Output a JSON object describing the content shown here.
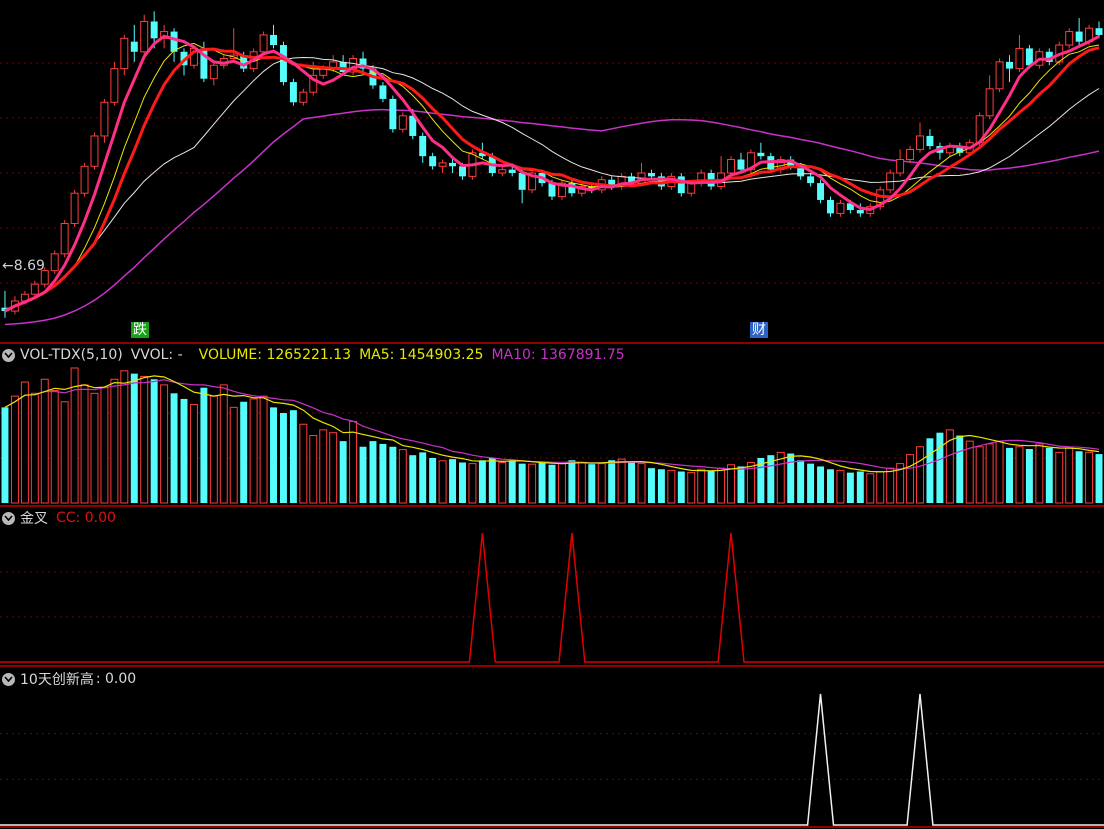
{
  "colors": {
    "background": "#000000",
    "up": "#ff3c3c",
    "down": "#54fcfc",
    "ma_fast": "#ff2f88",
    "ma_mid": "#ff1a1a",
    "ma_yellow": "#e8e800",
    "ma_white": "#e6e6e6",
    "ma_long": "#c832c8",
    "separator": "#c00000",
    "grid": "#7a0000"
  },
  "price_panel": {
    "low_label": "8.69",
    "event_tags": [
      {
        "text": "跌",
        "bar": 13,
        "color": "#18a018"
      },
      {
        "text": "财",
        "bar": 76,
        "color": "#2b63c8"
      }
    ]
  },
  "volume_panel": {
    "indicator": "VOL-TDX(5,10)",
    "vvol": "VVOL: -",
    "volume": "VOLUME: 1265221.13",
    "ma5": "MA5: 1454903.25",
    "ma10": "MA10: 1367891.75",
    "icon": "chevron-down-icon"
  },
  "gold_cross_panel": {
    "title": "金叉",
    "value": "CC: 0.00",
    "icon": "chevron-down-icon"
  },
  "new_high_panel": {
    "title": "10天创新高",
    "value": ": 0.00",
    "icon": "chevron-down-icon"
  },
  "chart_data": [
    {
      "type": "candlestick",
      "title": "",
      "bar_count": 111,
      "ylim": [
        8.3,
        13.2
      ],
      "y_reference": 8.69,
      "candles": [
        [
          8.75,
          8.7,
          9.0,
          8.6
        ],
        [
          8.7,
          8.85,
          8.92,
          8.65
        ],
        [
          8.85,
          8.95,
          9.0,
          8.8
        ],
        [
          8.95,
          9.1,
          9.15,
          8.9
        ],
        [
          9.1,
          9.3,
          9.35,
          9.05
        ],
        [
          9.3,
          9.55,
          9.6,
          9.25
        ],
        [
          9.55,
          10.0,
          10.05,
          9.5
        ],
        [
          10.0,
          10.45,
          10.5,
          9.95
        ],
        [
          10.45,
          10.85,
          10.9,
          10.4
        ],
        [
          10.85,
          11.3,
          11.35,
          10.8
        ],
        [
          11.3,
          11.8,
          11.85,
          11.2
        ],
        [
          11.8,
          12.3,
          12.4,
          11.75
        ],
        [
          12.3,
          12.75,
          12.8,
          12.2
        ],
        [
          12.7,
          12.55,
          12.95,
          12.4
        ],
        [
          12.55,
          13.0,
          13.1,
          12.5
        ],
        [
          13.0,
          12.75,
          13.15,
          12.6
        ],
        [
          12.75,
          12.85,
          12.95,
          12.6
        ],
        [
          12.85,
          12.55,
          12.9,
          12.4
        ],
        [
          12.55,
          12.35,
          12.6,
          12.2
        ],
        [
          12.35,
          12.6,
          12.65,
          12.3
        ],
        [
          12.6,
          12.15,
          12.7,
          12.1
        ],
        [
          12.15,
          12.35,
          12.4,
          12.05
        ],
        [
          12.35,
          12.45,
          12.5,
          12.3
        ],
        [
          12.45,
          12.5,
          12.9,
          12.4
        ],
        [
          12.5,
          12.3,
          12.55,
          12.25
        ],
        [
          12.3,
          12.55,
          12.6,
          12.25
        ],
        [
          12.55,
          12.8,
          12.85,
          12.5
        ],
        [
          12.8,
          12.65,
          12.95,
          12.6
        ],
        [
          12.65,
          12.1,
          12.7,
          12.05
        ],
        [
          12.1,
          11.8,
          12.15,
          11.75
        ],
        [
          11.8,
          11.95,
          12.0,
          11.75
        ],
        [
          11.95,
          12.2,
          12.4,
          11.9
        ],
        [
          12.2,
          12.3,
          12.35,
          12.15
        ],
        [
          12.3,
          12.4,
          12.5,
          12.25
        ],
        [
          12.4,
          12.25,
          12.5,
          12.2
        ],
        [
          12.25,
          12.45,
          12.5,
          12.2
        ],
        [
          12.45,
          12.3,
          12.55,
          12.25
        ],
        [
          12.3,
          12.05,
          12.35,
          12.0
        ],
        [
          12.05,
          11.85,
          12.1,
          11.8
        ],
        [
          11.85,
          11.4,
          11.9,
          11.35
        ],
        [
          11.4,
          11.6,
          11.65,
          11.35
        ],
        [
          11.6,
          11.3,
          11.7,
          11.25
        ],
        [
          11.3,
          11.0,
          11.35,
          10.9
        ],
        [
          11.0,
          10.85,
          11.05,
          10.8
        ],
        [
          10.85,
          10.9,
          10.95,
          10.75
        ],
        [
          10.9,
          10.85,
          11.0,
          10.75
        ],
        [
          10.85,
          10.7,
          10.9,
          10.65
        ],
        [
          10.7,
          11.05,
          11.1,
          10.65
        ],
        [
          11.05,
          11.0,
          11.2,
          10.95
        ],
        [
          11.0,
          10.75,
          11.05,
          10.7
        ],
        [
          10.75,
          10.8,
          10.85,
          10.7
        ],
        [
          10.8,
          10.75,
          10.85,
          10.7
        ],
        [
          10.75,
          10.5,
          10.8,
          10.3
        ],
        [
          10.5,
          10.75,
          10.8,
          10.45
        ],
        [
          10.75,
          10.6,
          10.8,
          10.55
        ],
        [
          10.6,
          10.4,
          10.65,
          10.35
        ],
        [
          10.4,
          10.6,
          10.65,
          10.35
        ],
        [
          10.6,
          10.45,
          10.65,
          10.4
        ],
        [
          10.45,
          10.55,
          10.6,
          10.4
        ],
        [
          10.55,
          10.5,
          10.6,
          10.45
        ],
        [
          10.5,
          10.65,
          10.7,
          10.45
        ],
        [
          10.65,
          10.55,
          10.7,
          10.5
        ],
        [
          10.55,
          10.7,
          10.75,
          10.5
        ],
        [
          10.7,
          10.6,
          10.75,
          10.55
        ],
        [
          10.6,
          10.75,
          10.9,
          10.55
        ],
        [
          10.75,
          10.7,
          10.8,
          10.65
        ],
        [
          10.7,
          10.55,
          10.75,
          10.5
        ],
        [
          10.55,
          10.7,
          10.75,
          10.5
        ],
        [
          10.7,
          10.45,
          10.75,
          10.4
        ],
        [
          10.45,
          10.6,
          10.65,
          10.4
        ],
        [
          10.6,
          10.75,
          10.8,
          10.55
        ],
        [
          10.75,
          10.55,
          10.8,
          10.5
        ],
        [
          10.55,
          10.75,
          11.0,
          10.5
        ],
        [
          10.75,
          10.95,
          11.0,
          10.7
        ],
        [
          10.95,
          10.8,
          11.05,
          10.75
        ],
        [
          10.8,
          11.05,
          11.1,
          10.75
        ],
        [
          11.05,
          11.0,
          11.2,
          10.95
        ],
        [
          11.0,
          10.8,
          11.05,
          10.75
        ],
        [
          10.8,
          10.95,
          11.0,
          10.75
        ],
        [
          10.95,
          10.85,
          11.0,
          10.8
        ],
        [
          10.85,
          10.7,
          10.9,
          10.65
        ],
        [
          10.7,
          10.6,
          10.75,
          10.55
        ],
        [
          10.6,
          10.35,
          10.65,
          10.3
        ],
        [
          10.35,
          10.15,
          10.4,
          10.1
        ],
        [
          10.15,
          10.3,
          10.35,
          10.1
        ],
        [
          10.3,
          10.2,
          10.35,
          10.15
        ],
        [
          10.2,
          10.15,
          10.3,
          10.1
        ],
        [
          10.15,
          10.25,
          10.3,
          10.1
        ],
        [
          10.25,
          10.5,
          10.55,
          10.2
        ],
        [
          10.5,
          10.75,
          10.8,
          10.45
        ],
        [
          10.75,
          10.95,
          11.1,
          10.7
        ],
        [
          10.95,
          11.1,
          11.15,
          10.9
        ],
        [
          11.1,
          11.3,
          11.5,
          11.05
        ],
        [
          11.3,
          11.15,
          11.4,
          11.1
        ],
        [
          11.15,
          11.05,
          11.2,
          10.95
        ],
        [
          11.05,
          11.15,
          11.2,
          11.0
        ],
        [
          11.15,
          11.05,
          11.2,
          11.0
        ],
        [
          11.05,
          11.2,
          11.25,
          11.0
        ],
        [
          11.2,
          11.6,
          11.65,
          11.15
        ],
        [
          11.6,
          12.0,
          12.2,
          11.55
        ],
        [
          12.0,
          12.4,
          12.45,
          11.95
        ],
        [
          12.4,
          12.3,
          12.5,
          12.1
        ],
        [
          12.3,
          12.6,
          12.8,
          12.25
        ],
        [
          12.6,
          12.35,
          12.65,
          12.3
        ],
        [
          12.35,
          12.55,
          12.6,
          12.3
        ],
        [
          12.55,
          12.4,
          12.6,
          12.35
        ],
        [
          12.4,
          12.65,
          12.7,
          12.35
        ],
        [
          12.65,
          12.85,
          12.9,
          12.6
        ],
        [
          12.85,
          12.7,
          13.05,
          12.65
        ],
        [
          12.7,
          12.9,
          12.95,
          12.65
        ],
        [
          12.9,
          12.8,
          13.0,
          12.75
        ]
      ],
      "series": [
        {
          "name": "",
          "color": "#ff2f88",
          "values": "ma5"
        },
        {
          "name": "",
          "color": "#ff1a1a",
          "values": "ma10"
        },
        {
          "name": "",
          "color": "#c832c8",
          "values": "ma60"
        }
      ]
    },
    {
      "type": "bar",
      "title": "VOL-TDX(5,10)",
      "ylim": [
        0,
        2400000
      ],
      "values": [
        1700000,
        1900000,
        2150000,
        1950000,
        2200000,
        2000000,
        1800000,
        2400000,
        2100000,
        1950000,
        2050000,
        2200000,
        2350000,
        2300000,
        2250000,
        2200000,
        2100000,
        1950000,
        1850000,
        1750000,
        2050000,
        1900000,
        2100000,
        1700000,
        1800000,
        1850000,
        1900000,
        1700000,
        1600000,
        1650000,
        1400000,
        1200000,
        1300000,
        1250000,
        1100000,
        1450000,
        1000000,
        1100000,
        1050000,
        1000000,
        950000,
        850000,
        900000,
        800000,
        750000,
        780000,
        720000,
        700000,
        760000,
        800000,
        720000,
        760000,
        700000,
        690000,
        720000,
        680000,
        700000,
        760000,
        720000,
        690000,
        700000,
        760000,
        780000,
        740000,
        700000,
        620000,
        600000,
        580000,
        560000,
        540000,
        600000,
        580000,
        620000,
        680000,
        650000,
        720000,
        800000,
        850000,
        900000,
        880000,
        760000,
        700000,
        650000,
        600000,
        580000,
        540000,
        560000,
        520000,
        560000,
        620000,
        700000,
        860000,
        1000000,
        1150000,
        1250000,
        1300000,
        1200000,
        1100000,
        1000000,
        1050000,
        1100000,
        980000,
        1000000,
        960000,
        1050000,
        980000,
        900000,
        980000,
        920000,
        900000,
        870000
      ],
      "ma5_value": 1454903.25,
      "ma10_value": 1367891.75
    },
    {
      "type": "line",
      "title": "金叉",
      "ylim": [
        0,
        1
      ],
      "spikes_at_bars": [
        48,
        57,
        73
      ]
    },
    {
      "type": "line",
      "title": "10天创新高",
      "ylim": [
        0,
        1
      ],
      "spikes_at_bars": [
        82,
        92
      ]
    }
  ]
}
